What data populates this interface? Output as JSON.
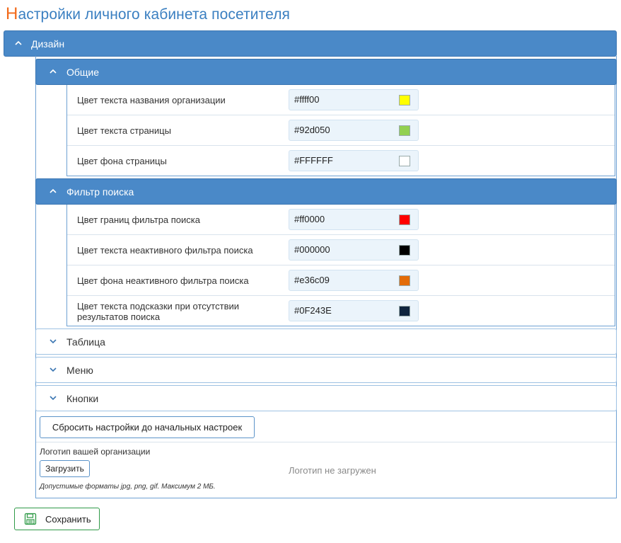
{
  "page": {
    "title_first_letter": "Н",
    "title_rest": "астройки личного кабинета посетителя"
  },
  "design": {
    "label": "Дизайн",
    "expanded": true
  },
  "general": {
    "label": "Общие",
    "rows": [
      {
        "label": "Цвет текста названия организации",
        "value": "#ffff00",
        "swatch": "#ffff00"
      },
      {
        "label": "Цвет текста страницы",
        "value": "#92d050",
        "swatch": "#92d050"
      },
      {
        "label": "Цвет фона страницы",
        "value": "#FFFFFF",
        "swatch": "#FFFFFF"
      }
    ]
  },
  "filter": {
    "label": "Фильтр поиска",
    "rows": [
      {
        "label": "Цвет границ фильтра поиска",
        "value": "#ff0000",
        "swatch": "#ff0000"
      },
      {
        "label": "Цвет текста неактивного фильтра поиска",
        "value": "#000000",
        "swatch": "#000000"
      },
      {
        "label": "Цвет фона неактивного фильтра поиска",
        "value": "#e36c09",
        "swatch": "#e36c09"
      },
      {
        "label_line1": "Цвет текста подсказки при отсутствии",
        "label_line2": "результатов поиска",
        "value": "#0F243E",
        "swatch": "#0F243E"
      }
    ]
  },
  "collapsed_sections": {
    "table": "Таблица",
    "menu": "Меню",
    "buttons": "Кнопки"
  },
  "actions": {
    "reset_label": "Сбросить настройки до начальных настроек",
    "save_label": "Сохранить"
  },
  "logo": {
    "heading": "Логотип вашей организации",
    "upload_label": "Загрузить",
    "status": "Логотип не загружен",
    "note": "Допустимые форматы jpg, png, gif. Максимум 2 МБ."
  },
  "icons": {
    "expanded": "chevron-up-icon",
    "collapsed": "chevron-down-icon",
    "save": "floppy-disk-icon"
  },
  "colors": {
    "accent": "#4a89c8",
    "title": "#3a7fc1",
    "title_first": "#f26a1b",
    "save_border": "#2f9a47"
  }
}
